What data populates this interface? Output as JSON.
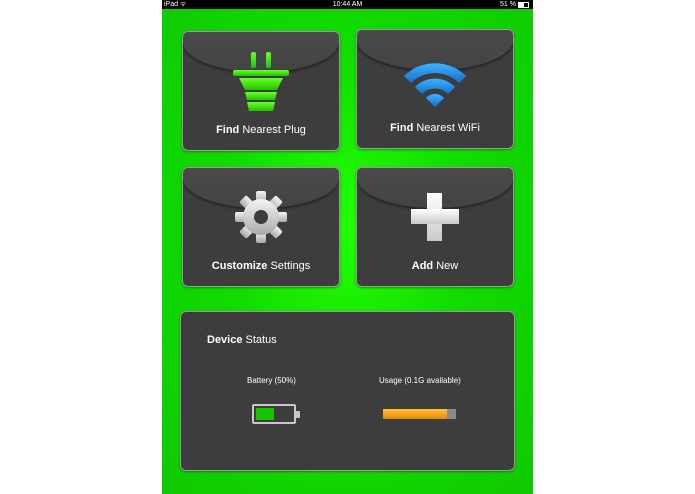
{
  "status_bar": {
    "device": "iPad",
    "time": "10:44 AM",
    "battery": "51 %"
  },
  "tiles": [
    {
      "bold": "Find",
      "rest": " Nearest Plug",
      "icon": "plug-icon"
    },
    {
      "bold": "Find",
      "rest": " Nearest WiFi",
      "icon": "wifi-icon"
    },
    {
      "bold": "Customize",
      "rest": " Settings",
      "icon": "gear-icon"
    },
    {
      "bold": "Add",
      "rest": " New",
      "icon": "plus-icon"
    }
  ],
  "device_status": {
    "title_bold": "Device",
    "title_rest": " Status",
    "battery_label": "Battery (50%)",
    "battery_level": 0.5,
    "usage_label": "Usage (0.1G available)",
    "usage_level": 0.87
  },
  "colors": {
    "background": "#10c800",
    "tile": "#3d3d3d",
    "accent_green": "#3fe000",
    "wifi_blue": "#1e8fe6",
    "usage_orange": "#f39d18"
  }
}
